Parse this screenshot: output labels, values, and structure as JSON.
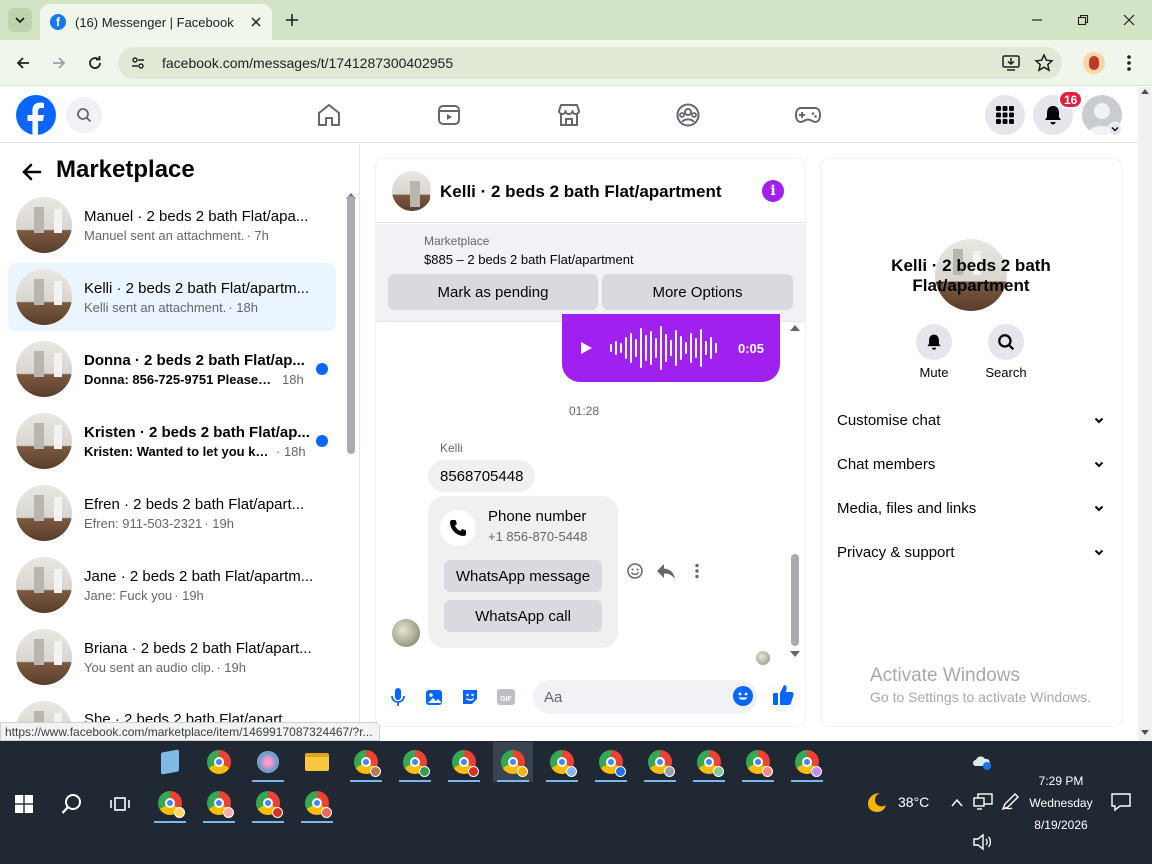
{
  "browser": {
    "tab_title": "(16) Messenger | Facebook",
    "url": "facebook.com/messages/t/1741287300402955",
    "status_url": "https://www.facebook.com/marketplace/item/1469917087324467/?r..."
  },
  "fb_nav": {
    "notification_count": "16"
  },
  "sidebar": {
    "title": "Marketplace",
    "conversations": [
      {
        "name": "Manuel · 2 beds 2 bath Flat/apa...",
        "preview": "Manuel sent an attachment.",
        "time": "· 7h",
        "unread": false
      },
      {
        "name": "Kelli · 2 beds 2 bath Flat/apartm...",
        "preview": "Kelli sent an attachment.",
        "time": "· 18h",
        "unread": false
      },
      {
        "name": "Donna · 2 beds 2 bath Flat/ap...",
        "preview": "Donna: 856-725-9751 Please d...",
        "time": "18h",
        "unread": true
      },
      {
        "name": "Kristen · 2 beds 2 bath Flat/ap...",
        "preview": "Kristen: Wanted to let you kno...",
        "time": "· 18h",
        "unread": true
      },
      {
        "name": "Efren · 2 beds 2 bath Flat/apart...",
        "preview": "Efren: 911-503-2321",
        "time": "· 19h",
        "unread": false
      },
      {
        "name": "Jane · 2 beds 2 bath Flat/apartm...",
        "preview": "Jane: Fuck you",
        "time": "· 19h",
        "unread": false
      },
      {
        "name": "Briana · 2 beds 2 bath Flat/apart...",
        "preview": "You sent an audio clip.",
        "time": "· 19h",
        "unread": false
      },
      {
        "name": "She · 2 beds 2 bath Flat/apart...",
        "preview": "",
        "time": "",
        "unread": false
      }
    ]
  },
  "chat": {
    "title": "Kelli · 2 beds 2 bath Flat/apartment",
    "info_glyph": "i",
    "marketplace_label": "Marketplace",
    "listing_price": "$885 – 2 beds 2 bath Flat/apartment",
    "mark_pending": "Mark as pending",
    "more_options": "More Options",
    "audio_duration": "0:05",
    "timestamp": "01:28",
    "sender": "Kelli",
    "message_text": "8568705448",
    "phone_card_title": "Phone number",
    "phone_card_number": "+1 856-870-5448",
    "whatsapp_message": "WhatsApp message",
    "whatsapp_call": "WhatsApp call",
    "input_placeholder": "Aa"
  },
  "info_panel": {
    "title": "Kelli · 2 beds 2 bath Flat/apartment",
    "mute_label": "Mute",
    "search_label": "Search",
    "sections": [
      "Customise chat",
      "Chat members",
      "Media, files and links",
      "Privacy & support"
    ]
  },
  "watermark": {
    "line1": "Activate Windows",
    "line2": "Go to Settings to activate Windows."
  },
  "taskbar": {
    "weather": "38°C",
    "time": "7:29 PM",
    "day": "Wednesday",
    "date": "8/19/2026"
  },
  "colors": {
    "fb_blue": "#0866ff",
    "messenger_purple": "#a020f0",
    "unread_dot": "#0866ff",
    "notification_red": "#e41e3f"
  }
}
